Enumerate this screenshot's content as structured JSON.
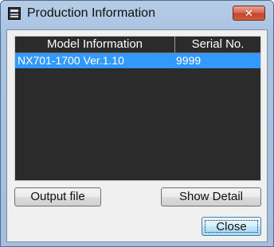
{
  "window": {
    "title": "Production Information",
    "close_glyph": "✕"
  },
  "table": {
    "columns": [
      "Model Information",
      "Serial No."
    ],
    "rows": [
      {
        "model": "NX701-1700 Ver.1.10",
        "serial": "9999",
        "selected": true
      }
    ]
  },
  "buttons": {
    "output_file": "Output file",
    "show_detail": "Show Detail",
    "close": "Close"
  },
  "colors": {
    "selection": "#3399ff",
    "list_background": "#2b2b2b"
  }
}
